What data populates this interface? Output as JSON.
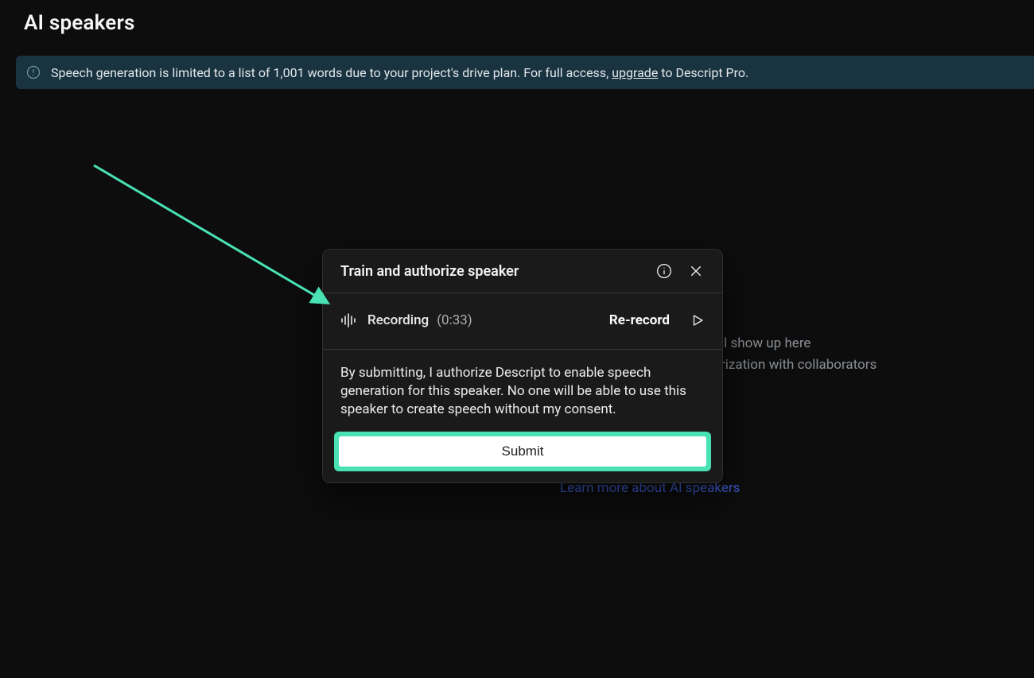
{
  "page": {
    "title": "AI speakers"
  },
  "notice": {
    "prefix": "Speech generation is limited to a list of 1,001 words due to your project's drive plan. For full access, ",
    "link": "upgrade",
    "suffix": " to Descript Pro."
  },
  "background": {
    "line1_fragment": "ll show up here",
    "line2_fragment": "rization with collaborators",
    "learn_more": "Learn more about AI speakers"
  },
  "modal": {
    "title": "Train and authorize speaker",
    "recording_label": "Recording",
    "recording_time": "(0:33)",
    "re_record": "Re-record",
    "authorization_text": "By submitting, I authorize Descript to enable speech generation for this speaker. No one will be able to use this speaker to create speech without my consent.",
    "submit": "Submit"
  },
  "annotation": {
    "arrow_color": "#48e2b4"
  }
}
